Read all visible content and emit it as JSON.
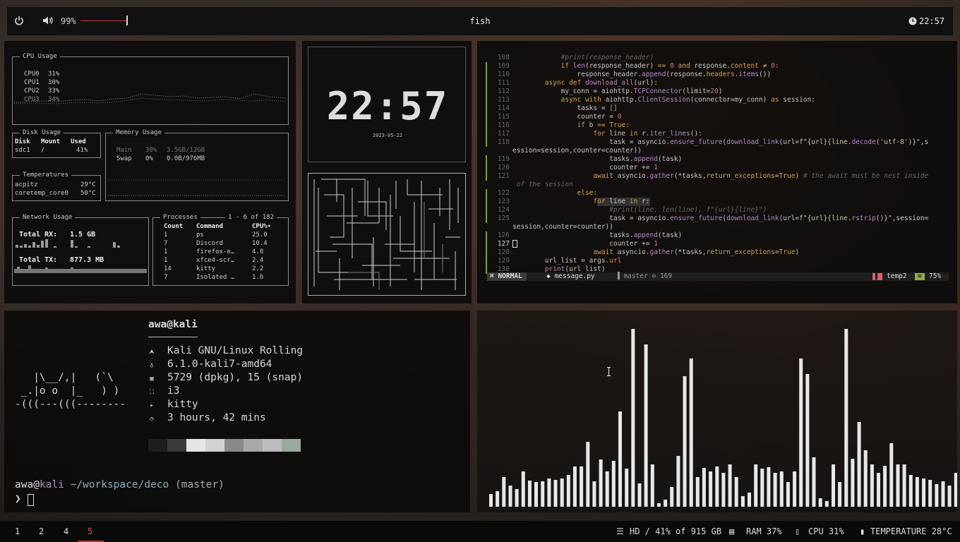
{
  "topbar": {
    "volume_pct": "99%",
    "volume_level": 0.99,
    "window_title": "fish",
    "clock": "22:57"
  },
  "sysmon": {
    "cpu": {
      "title": "CPU Usage",
      "cores": [
        {
          "label": "CPU0",
          "pct": "31%"
        },
        {
          "label": "CPU1",
          "pct": "30%"
        },
        {
          "label": "CPU2",
          "pct": "33%"
        },
        {
          "label": "CPU3",
          "pct": "34%"
        }
      ]
    },
    "disk": {
      "title": "Disk Usage",
      "headers": [
        "Disk",
        "Mount",
        "Used"
      ],
      "row": [
        "sdc1",
        "/",
        "41%"
      ]
    },
    "memory": {
      "title": "Memory Usage",
      "rows": [
        {
          "name": "Main",
          "pct": "30%",
          "val": "3.5GB/12GB"
        },
        {
          "name": "Swap",
          "pct": "0%",
          "val": "0.0B/976MB"
        }
      ]
    },
    "temps": {
      "title": "Temperatures",
      "rows": [
        {
          "name": "acpitz",
          "val": "29°C"
        },
        {
          "name": "coretemp_core0",
          "val": "50°C"
        }
      ]
    },
    "network": {
      "title": "Network Usage",
      "rx_label": "Total RX:",
      "rx_val": "1.5 GB",
      "tx_label": "Total TX:",
      "tx_val": "877.3 MB"
    },
    "processes": {
      "title": "Processes",
      "range": "1 - 6 of 182",
      "headers": [
        "Count",
        "Command",
        "CPU%▾"
      ],
      "rows": [
        [
          "1",
          "ps",
          "25.0"
        ],
        [
          "7",
          "Discord",
          "10.4"
        ],
        [
          "1",
          "firefox-e…",
          "4.8"
        ],
        [
          "1",
          "xfce4-scr…",
          "2.4"
        ],
        [
          "14",
          "kitty",
          "2.2"
        ],
        [
          "7",
          "Isolated …",
          "1.6"
        ]
      ]
    }
  },
  "clock_panel": {
    "time": "22:57",
    "date": "2023-05-22"
  },
  "editor": {
    "lines": [
      {
        "n": "108",
        "segs": [
          [
            "cm",
            "            #print(response_header)"
          ]
        ]
      },
      {
        "n": "109",
        "segs": [
          [
            "kw",
            "            if "
          ],
          [
            "fn",
            "len"
          ],
          [
            "tx",
            "(response_header) "
          ],
          [
            "kw",
            "== "
          ],
          [
            "nm",
            "0 "
          ],
          [
            "kw",
            "and "
          ],
          [
            "tx",
            "response."
          ],
          [
            "kw",
            "content "
          ],
          [
            "kw",
            "≠ "
          ],
          [
            "nm",
            "0"
          ],
          [
            "kw",
            ":"
          ]
        ]
      },
      {
        "n": "110",
        "segs": [
          [
            "tx",
            "                response_header."
          ],
          [
            "fn",
            "append"
          ],
          [
            "tx",
            "(response."
          ],
          [
            "kw",
            "headers"
          ],
          [
            "tx",
            "."
          ],
          [
            "fn",
            "items"
          ],
          [
            "tx",
            "())"
          ]
        ]
      },
      {
        "n": "111",
        "segs": [
          [
            "kw",
            "        async def "
          ],
          [
            "fn",
            "download_all"
          ],
          [
            "tx",
            "(url)"
          ],
          [
            "kw",
            ":"
          ]
        ]
      },
      {
        "n": "112",
        "segs": [
          [
            "tx",
            "            my_conn = aiohttp."
          ],
          [
            "fn",
            "TCPConnector"
          ],
          [
            "tx",
            "(limit="
          ],
          [
            "nm",
            "20"
          ],
          [
            "tx",
            ")"
          ]
        ]
      },
      {
        "n": "113",
        "segs": [
          [
            "kw",
            "            async with "
          ],
          [
            "tx",
            "aiohttp."
          ],
          [
            "fn",
            "ClientSession"
          ],
          [
            "tx",
            "(connector=my_conn) "
          ],
          [
            "kw",
            "as "
          ],
          [
            "tx",
            "session:"
          ]
        ]
      },
      {
        "n": "114",
        "segs": [
          [
            "tx",
            "                tasks = "
          ],
          [
            "kw",
            "[]"
          ]
        ]
      },
      {
        "n": "115",
        "segs": [
          [
            "tx",
            "                counter = "
          ],
          [
            "nm",
            "0"
          ]
        ]
      },
      {
        "n": "116",
        "segs": [
          [
            "kw",
            "                if "
          ],
          [
            "tx",
            "b "
          ],
          [
            "kw",
            "== "
          ],
          [
            "kw",
            "True:"
          ]
        ]
      },
      {
        "n": "117",
        "segs": [
          [
            "kw",
            "                    for "
          ],
          [
            "tx",
            "line "
          ],
          [
            "kw",
            "in "
          ],
          [
            "tx",
            "r."
          ],
          [
            "fn",
            "iter_lines"
          ],
          [
            "tx",
            "()"
          ],
          [
            "kw",
            ":"
          ]
        ]
      },
      {
        "n": "118",
        "segs": [
          [
            "tx",
            "                        task = asyncio."
          ],
          [
            "fn",
            "ensure_future"
          ],
          [
            "tx",
            "("
          ],
          [
            "fn",
            "download_link"
          ],
          [
            "tx",
            "(url="
          ],
          [
            "st",
            "f\"{url}{line."
          ],
          [
            "fn",
            "decode"
          ],
          [
            "st",
            "('utf-8')}\""
          ],
          [
            "tx",
            ",s"
          ]
        ]
      },
      {
        "n": "",
        "segs": [
          [
            "tx",
            "ession=session,counter=counter))"
          ]
        ]
      },
      {
        "n": "119",
        "segs": [
          [
            "tx",
            "                        tasks."
          ],
          [
            "fn",
            "append"
          ],
          [
            "tx",
            "(task)"
          ]
        ]
      },
      {
        "n": "120",
        "segs": [
          [
            "tx",
            "                        counter += "
          ],
          [
            "nm",
            "1"
          ]
        ]
      },
      {
        "n": "121",
        "segs": [
          [
            "kw",
            "                    await "
          ],
          [
            "tx",
            "asyncio."
          ],
          [
            "fn",
            "gather"
          ],
          [
            "tx",
            "(*tasks,"
          ],
          [
            "kw",
            "return_exceptions"
          ],
          [
            "tx",
            "="
          ],
          [
            "kw",
            "True"
          ],
          [
            "tx",
            ") "
          ],
          [
            "cm",
            "# the await must be nest inside"
          ]
        ]
      },
      {
        "n": "",
        "segs": [
          [
            "cm",
            " of the session"
          ]
        ]
      },
      {
        "n": "122",
        "segs": [
          [
            "kw",
            "                else:"
          ]
        ]
      },
      {
        "n": "123",
        "segs": [
          [
            "kw",
            "                    for "
          ],
          [
            "tx",
            "line "
          ],
          [
            "kw",
            "in "
          ],
          [
            "tx",
            "r:"
          ]
        ]
      },
      {
        "n": "124",
        "segs": [
          [
            "cm",
            "                        #print(line, len(line), f\"{url}{line}\")"
          ]
        ]
      },
      {
        "n": "125",
        "segs": [
          [
            "tx",
            "                        task = asyncio."
          ],
          [
            "fn",
            "ensure_future"
          ],
          [
            "tx",
            "("
          ],
          [
            "fn",
            "download_link"
          ],
          [
            "tx",
            "(url="
          ],
          [
            "st",
            "f\"{url}{line."
          ],
          [
            "fn",
            "rstrip"
          ],
          [
            "st",
            "()}\""
          ],
          [
            "tx",
            ",session="
          ]
        ]
      },
      {
        "n": "",
        "segs": [
          [
            "tx",
            "session,counter=counter))"
          ]
        ]
      },
      {
        "n": "126",
        "segs": [
          [
            "tx",
            "                        tasks."
          ],
          [
            "fn",
            "append"
          ],
          [
            "tx",
            "(task)"
          ]
        ]
      },
      {
        "n": "127",
        "segs": [
          [
            "tx",
            "                        counter += "
          ],
          [
            "nm",
            "1"
          ]
        ]
      },
      {
        "n": "128",
        "segs": [
          [
            "kw",
            "                    await "
          ],
          [
            "tx",
            "asyncio."
          ],
          [
            "fn",
            "gather"
          ],
          [
            "tx",
            "(*tasks,"
          ],
          [
            "kw",
            "return_exceptions"
          ],
          [
            "tx",
            "="
          ],
          [
            "kw",
            "True"
          ],
          [
            "tx",
            ")"
          ]
        ]
      },
      {
        "n": "129",
        "segs": [
          [
            "tx",
            "        url_list = args."
          ],
          [
            "kw",
            "url"
          ]
        ]
      },
      {
        "n": "130",
        "segs": [
          [
            "tx",
            "        "
          ],
          [
            "fn",
            "print"
          ],
          [
            "tx",
            "(url_list)"
          ]
        ]
      }
    ],
    "status": {
      "mode": "NORMAL",
      "file": "message.py",
      "branch": "master",
      "changes": "169",
      "ft": "temp2",
      "pct": "75%"
    }
  },
  "fetch": {
    "user": "awa",
    "host": "kali",
    "rows": [
      {
        "icon": "distro-icon",
        "glyph": "⮝",
        "text": "Kali GNU/Linux Rolling"
      },
      {
        "icon": "kernel-icon",
        "glyph": "♁",
        "text": "6.1.0-kali7-amd64"
      },
      {
        "icon": "package-icon",
        "glyph": "▣",
        "text": "5729 (dpkg), 15 (snap)"
      },
      {
        "icon": "wm-icon",
        "glyph": "⛶",
        "text": "i3"
      },
      {
        "icon": "terminal-icon",
        "glyph": "▸",
        "text": "kitty"
      },
      {
        "icon": "uptime-icon",
        "glyph": "◷",
        "text": "3 hours, 42 mins"
      }
    ],
    "ascii": [
      "   |\\__/,|   (`\\",
      " _.|o o  |_   ) )",
      "-(((---(((--------"
    ],
    "swatches": [
      "#1e1e1e",
      "#3a3a3a",
      "#e6e6e6",
      "#d2d2d2",
      "#8a8a8a",
      "#a8a8a8",
      "#bcbcbc",
      "#9aaa9a"
    ],
    "prompt": {
      "user": "awa",
      "host": "kali",
      "path": "~/workspace/deco",
      "branch": "(master)",
      "symbol": "❯"
    }
  },
  "visualizer": {
    "levels": [
      18,
      22,
      42,
      30,
      25,
      50,
      37,
      35,
      36,
      40,
      38,
      40,
      45,
      57,
      57,
      92,
      36,
      67,
      50,
      65,
      135,
      54,
      252,
      33,
      230,
      60,
      5,
      10,
      28,
      72,
      185,
      210,
      42,
      55,
      50,
      57,
      48,
      60,
      42,
      15,
      20,
      60,
      54,
      56,
      48,
      50,
      35,
      50,
      210,
      188,
      70,
      12,
      8,
      60,
      35,
      252,
      68,
      120,
      80,
      60,
      48,
      58,
      90,
      60,
      60,
      45,
      42,
      40,
      38,
      32,
      36,
      30,
      48,
      25,
      32,
      22,
      25
    ]
  },
  "bottombar": {
    "workspaces": [
      "1",
      "2",
      "4",
      "5"
    ],
    "active_workspace": "5",
    "hd": "HD / 41% of 915 GB",
    "ram": "RAM 37%",
    "cpu": "CPU 31%",
    "temp": "TEMPERATURE 28°C"
  }
}
